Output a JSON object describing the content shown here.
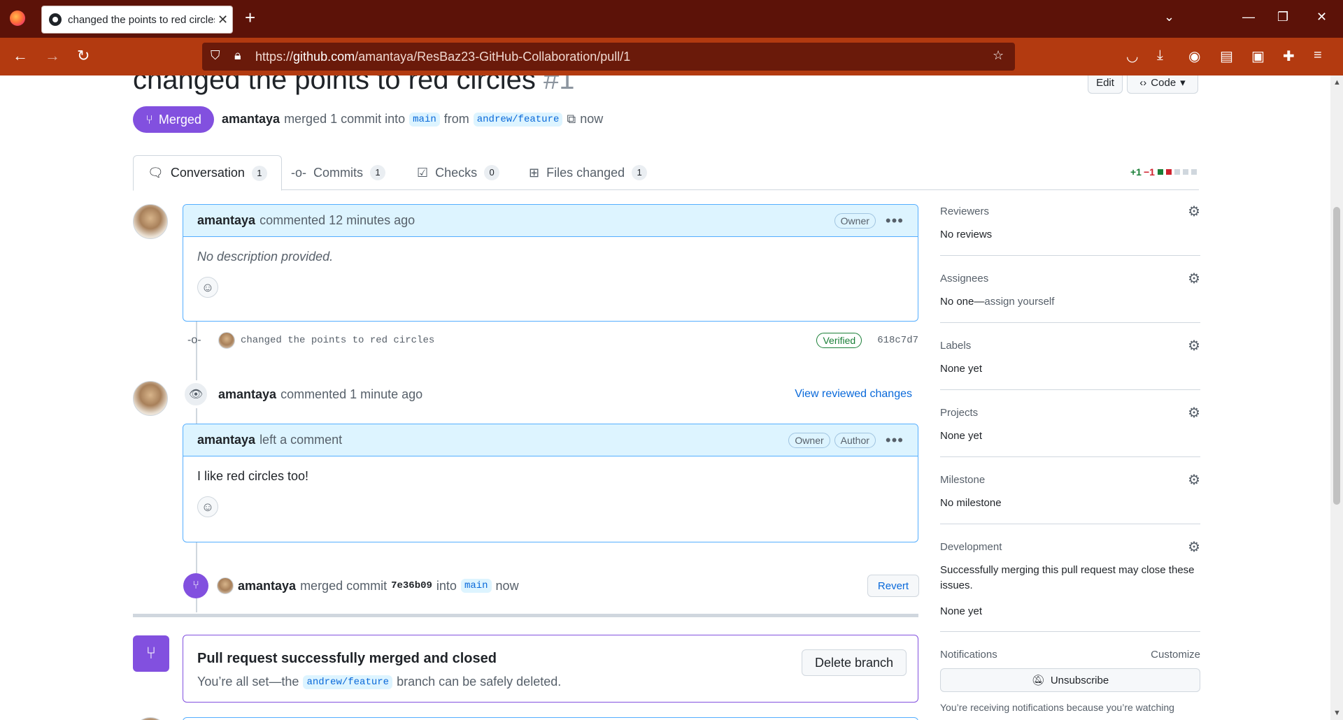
{
  "browser": {
    "tab_title": "changed the points to red circles",
    "tab_close": "✕",
    "new_tab": "+",
    "url_prefix": "https://",
    "url_domain": "github.com",
    "url_path": "/amantaya/ResBaz23-GitHub-Collaboration/pull/1"
  },
  "pr": {
    "title": "changed the points to red circles",
    "number": "#1",
    "state": "Merged",
    "author": "amantaya",
    "action": "merged 1 commit into",
    "base_branch": "main",
    "from_word": "from",
    "head_branch": "andrew/feature",
    "time": "now",
    "edit_label": "Edit",
    "code_label": "Code"
  },
  "tabs": [
    {
      "label": "Conversation",
      "count": "1"
    },
    {
      "label": "Commits",
      "count": "1"
    },
    {
      "label": "Checks",
      "count": "0"
    },
    {
      "label": "Files changed",
      "count": "1"
    }
  ],
  "diffstat": {
    "additions": "+1",
    "deletions": "−1",
    "add_color": "#1a7f37",
    "del_color": "#cf222e"
  },
  "comment1": {
    "author": "amantaya",
    "meta": "commented 12 minutes ago",
    "badge": "Owner",
    "body": "No description provided."
  },
  "commit": {
    "message": "changed the points to red circles",
    "verified": "Verified",
    "sha": "618c7d7"
  },
  "review": {
    "author": "amantaya",
    "meta": "commented 1 minute ago",
    "link": "View reviewed changes"
  },
  "comment2": {
    "author": "amantaya",
    "meta": "left a comment",
    "badge_owner": "Owner",
    "badge_author": "Author",
    "body": "I like red circles too!"
  },
  "merge_event": {
    "author": "amantaya",
    "text1": "merged commit",
    "sha": "7e36b09",
    "text2": "into",
    "branch": "main",
    "time": "now",
    "revert_label": "Revert"
  },
  "merged_box": {
    "title": "Pull request successfully merged and closed",
    "sub1": "You’re all set—the",
    "branch": "andrew/feature",
    "sub2": "branch can be safely deleted.",
    "delete_label": "Delete branch"
  },
  "sidebar": {
    "reviewers": {
      "head": "Reviewers",
      "value": "No reviews"
    },
    "assignees": {
      "head": "Assignees",
      "value": "No one—",
      "link": "assign yourself"
    },
    "labels": {
      "head": "Labels",
      "value": "None yet"
    },
    "projects": {
      "head": "Projects",
      "value": "None yet"
    },
    "milestone": {
      "head": "Milestone",
      "value": "No milestone"
    },
    "development": {
      "head": "Development",
      "desc": "Successfully merging this pull request may close these issues.",
      "value": "None yet"
    },
    "notifications": {
      "head": "Notifications",
      "customize": "Customize",
      "unsubscribe": "Unsubscribe",
      "footer": "You’re receiving notifications because you’re watching"
    }
  },
  "colors": {
    "merged": "#8250df",
    "link": "#0969da",
    "browser_tab_bar": "#5c1208",
    "browser_nav_bar": "#b33a10"
  }
}
